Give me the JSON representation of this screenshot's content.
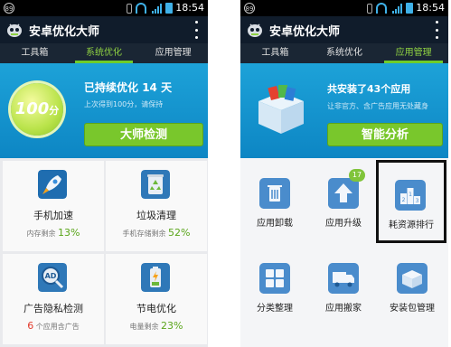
{
  "left": {
    "status": {
      "badge": "89",
      "time": "18:54"
    },
    "app_title": "安卓优化大师",
    "tabs": [
      {
        "label": "工具箱",
        "active": false
      },
      {
        "label": "系统优化",
        "active": true
      },
      {
        "label": "应用管理",
        "active": false
      }
    ],
    "hero": {
      "score_value": "100",
      "score_unit": "分",
      "optimized_prefix": "已持续优化",
      "optimized_days": "14",
      "optimized_suffix": "天",
      "subline": "上次得到100分，请保持",
      "button": "大师检测"
    },
    "tiles": [
      {
        "name": "手机加速",
        "stat_label": "内存剩余",
        "stat_value": "13%",
        "icon": "rocket-icon"
      },
      {
        "name": "垃圾清理",
        "stat_label": "手机存储剩余",
        "stat_value": "52%",
        "icon": "recycle-icon"
      },
      {
        "name": "广告隐私检测",
        "stat_value": "6",
        "stat_label": "个应用含广告",
        "icon": "ad-scan-icon"
      },
      {
        "name": "节电优化",
        "stat_label": "电量剩余",
        "stat_value": "23%",
        "icon": "battery-icon"
      }
    ]
  },
  "right": {
    "status": {
      "badge": "89",
      "time": "18:54"
    },
    "app_title": "安卓优化大师",
    "tabs": [
      {
        "label": "工具箱",
        "active": false
      },
      {
        "label": "系统优化",
        "active": false
      },
      {
        "label": "应用管理",
        "active": true
      }
    ],
    "hero": {
      "installed_prefix": "共安装了",
      "installed_count": "43",
      "installed_suffix": "个应用",
      "subline": "让非官方、含广告应用无处藏身",
      "button": "智能分析"
    },
    "tiles": [
      {
        "name": "应用卸载",
        "icon": "trash-icon"
      },
      {
        "name": "应用升级",
        "icon": "upgrade-arrow-icon",
        "badge": "17"
      },
      {
        "name": "耗资源排行",
        "icon": "ranking-podium-icon",
        "highlighted": true
      },
      {
        "name": "分类整理",
        "icon": "category-grid-icon"
      },
      {
        "name": "应用搬家",
        "icon": "moving-truck-icon"
      },
      {
        "name": "安装包管理",
        "icon": "package-box-icon"
      }
    ]
  },
  "colors": {
    "accent_green": "#79c72c",
    "hero_blue": "#1a9ad6",
    "header_dark": "#101c2b",
    "tab_active": "#8fd142",
    "highlight_border": "#111111",
    "stat_red": "#e23a2b"
  }
}
